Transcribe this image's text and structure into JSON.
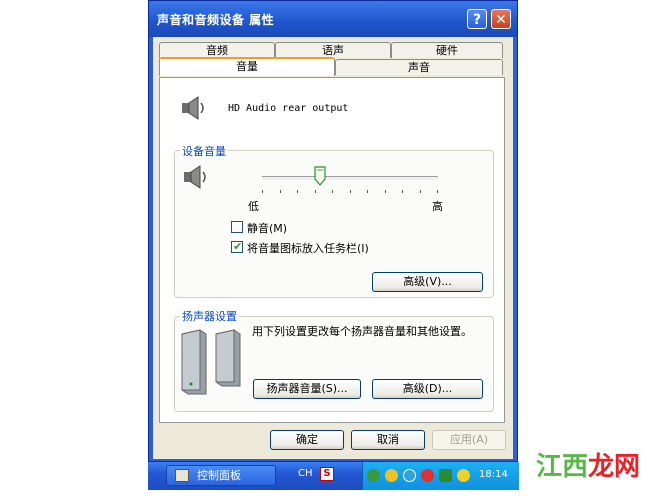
{
  "window": {
    "title": "声音和音频设备 属性",
    "help_glyph": "?",
    "close_glyph": "✕"
  },
  "tabs": {
    "row1": [
      "音频",
      "语声",
      "硬件"
    ],
    "row2": [
      "音量",
      "声音"
    ],
    "active": "音量"
  },
  "device": {
    "name": "HD Audio rear output"
  },
  "device_volume": {
    "group_title": "设备音量",
    "low_label": "低",
    "high_label": "高",
    "slider_level_percent": 33,
    "mute_label": "静音(M)",
    "mute_checked": false,
    "taskbar_icon_label": "将音量图标放入任务栏(I)",
    "taskbar_icon_checked": true,
    "advanced_label": "高级(V)..."
  },
  "speaker_settings": {
    "group_title": "扬声器设置",
    "description": "用下列设置更改每个扬声器音量和其他设置。",
    "volume_button": "扬声器音量(S)...",
    "advanced_button": "高级(D)..."
  },
  "dialog_buttons": {
    "ok": "确定",
    "cancel": "取消",
    "apply": "应用(A)"
  },
  "taskbar": {
    "item_label": "控制面板",
    "ime_label": "CH",
    "ime_icon": "S",
    "clock": "18:14"
  },
  "watermark": {
    "part1": "江",
    "part2": "西",
    "part3": "龙网"
  },
  "colors": {
    "titlebar": "#1f55cc",
    "group_title": "#0046d5",
    "tab_highlight": "#f0a020",
    "checkmark": "#21a121"
  }
}
